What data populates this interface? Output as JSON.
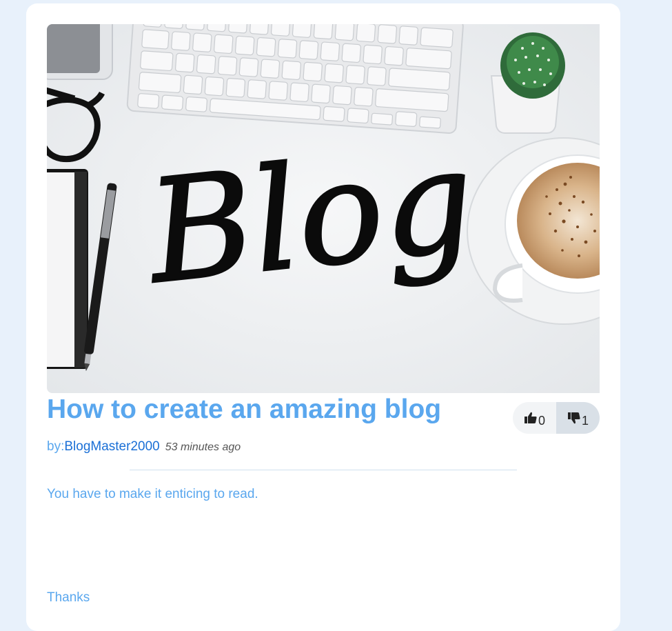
{
  "post": {
    "hero_word": "Blog",
    "title": "How to create an amazing blog",
    "byline_prefix": "by:",
    "author": "BlogMaster2000",
    "time_ago": "53 minutes ago",
    "body": "You have to make it enticing to read.",
    "signoff": "Thanks"
  },
  "votes": {
    "up_icon": "thumbs-up-icon",
    "up_count": "0",
    "down_icon": "thumbs-down-icon",
    "down_count": "1"
  },
  "colors": {
    "page_bg": "#e8f1fb",
    "card_bg": "#ffffff",
    "accent": "#5aa7ee",
    "link": "#1a6fd6",
    "muted": "#555555"
  }
}
